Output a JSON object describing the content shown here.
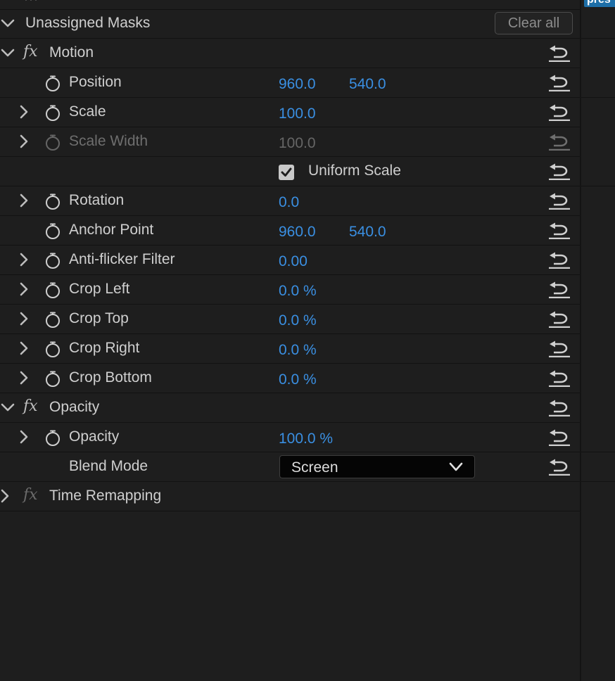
{
  "top_right_tab": "pres",
  "top_strip_text": "···",
  "unassigned_masks": {
    "label": "Unassigned Masks",
    "clear_label": "Clear all"
  },
  "motion": {
    "fx": "fx",
    "label": "Motion",
    "properties": [
      {
        "label": "Position",
        "value1": "960.0",
        "value2": "540.0"
      },
      {
        "label": "Scale",
        "value1": "100.0"
      },
      {
        "label": "Scale Width",
        "value1": "100.0"
      },
      {
        "label": "Uniform Scale",
        "checked": true
      },
      {
        "label": "Rotation",
        "value1": "0.0"
      },
      {
        "label": "Anchor Point",
        "value1": "960.0",
        "value2": "540.0"
      },
      {
        "label": "Anti-flicker Filter",
        "value1": "0.00"
      },
      {
        "label": "Crop Left",
        "value1": "0.0 %"
      },
      {
        "label": "Crop Top",
        "value1": "0.0 %"
      },
      {
        "label": "Crop Right",
        "value1": "0.0 %"
      },
      {
        "label": "Crop Bottom",
        "value1": "0.0 %"
      }
    ]
  },
  "opacity": {
    "fx": "fx",
    "label": "Opacity",
    "properties": [
      {
        "label": "Opacity",
        "value1": "100.0 %"
      },
      {
        "label": "Blend Mode",
        "select_value": "Screen"
      }
    ]
  },
  "time_remapping": {
    "fx": "fx",
    "label": "Time Remapping"
  },
  "colors": {
    "value_blue": "#3a8fe2",
    "panel_bg": "#1e1e1e",
    "tab_blue": "#1e6fa8"
  }
}
